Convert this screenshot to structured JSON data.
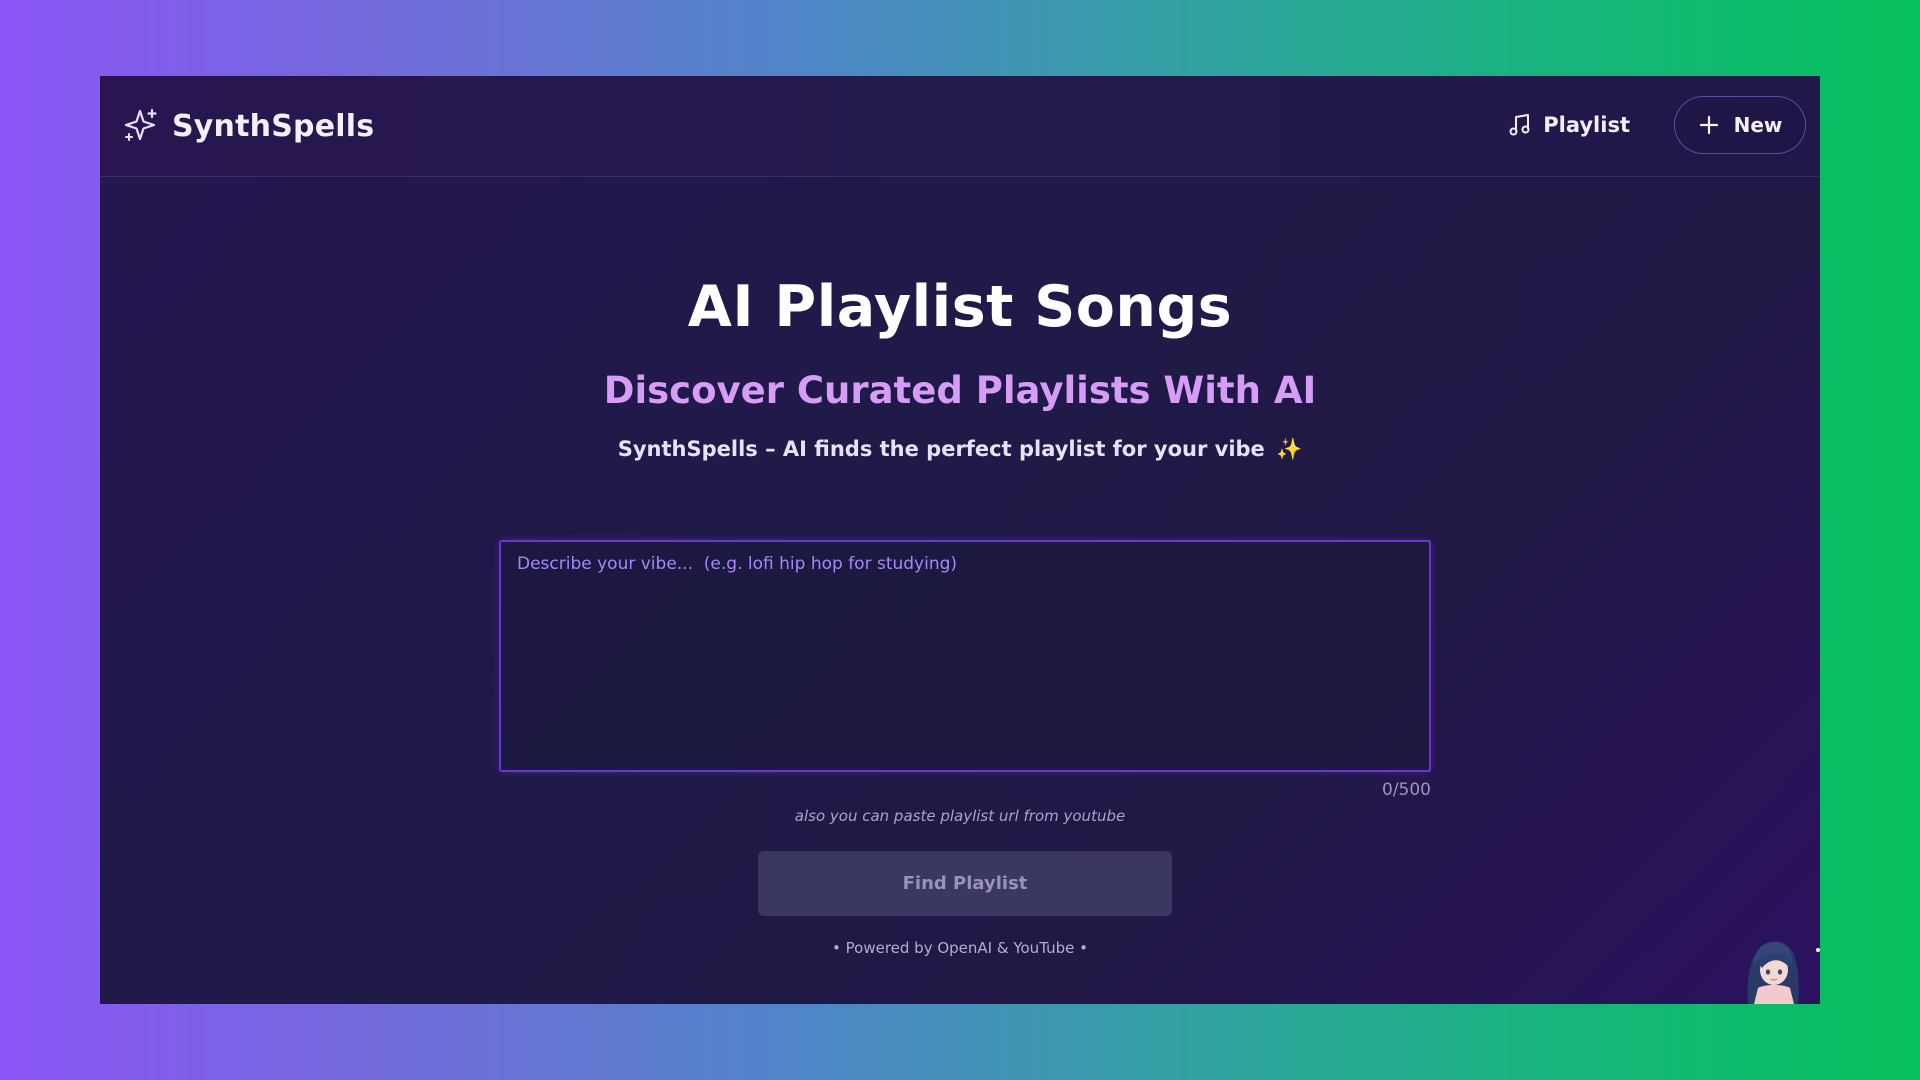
{
  "header": {
    "brand_name": "SynthSpells",
    "brand_icon": "sparkles-icon",
    "nav_playlist_label": "Playlist",
    "nav_playlist_icon": "music-note-icon",
    "new_button_label": "New",
    "new_button_icon": "plus-icon"
  },
  "hero": {
    "title": "AI Playlist Songs",
    "subtitle": "Discover Curated Playlists With AI",
    "tagline": "SynthSpells – AI finds the perfect playlist for your vibe",
    "tagline_emoji": "✨"
  },
  "form": {
    "vibe_value": "",
    "vibe_placeholder": "Describe your vibe...  (e.g. lofi hip hop for studying)",
    "char_count": "0/500",
    "hint": "also you can paste playlist url from youtube",
    "submit_label": "Find Playlist"
  },
  "footer": {
    "powered_by": "• Powered by OpenAI & YouTube •"
  },
  "colors": {
    "accent": "#6a33d6",
    "subtitle": "#d79cf8",
    "placeholder": "#a687f4",
    "button_disabled_bg": "#3a3762"
  }
}
